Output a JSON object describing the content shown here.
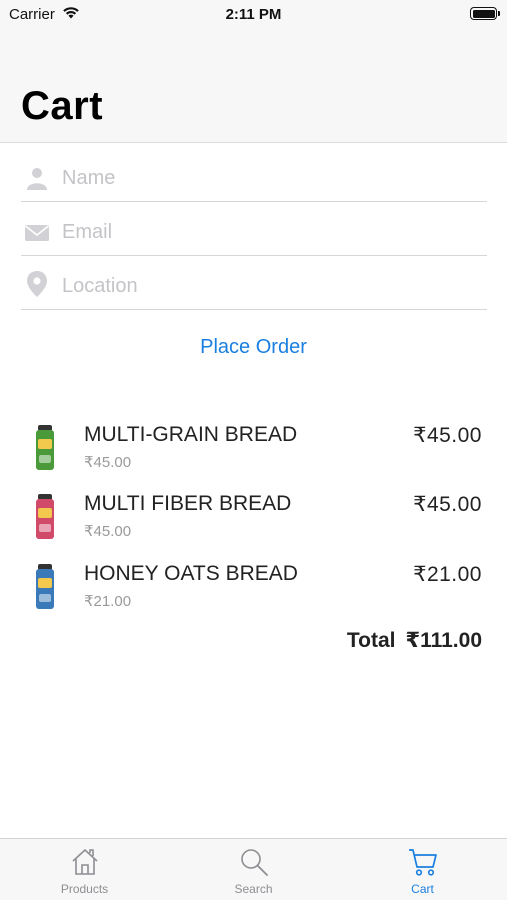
{
  "status_bar": {
    "carrier": "Carrier",
    "time": "2:11 PM"
  },
  "header": {
    "title": "Cart"
  },
  "form": {
    "name": {
      "value": "",
      "placeholder": "Name",
      "icon": "person-icon"
    },
    "email": {
      "value": "",
      "placeholder": "Email",
      "icon": "envelope-icon"
    },
    "location": {
      "value": "",
      "placeholder": "Location",
      "icon": "location-pin-icon"
    }
  },
  "place_order_label": "Place Order",
  "items": [
    {
      "name": "MULTI-GRAIN BREAD",
      "unit_price": "₹45.00",
      "total": "₹45.00",
      "pack_color": "#4a9a3a"
    },
    {
      "name": "MULTI FIBER BREAD",
      "unit_price": "₹45.00",
      "total": "₹45.00",
      "pack_color": "#d24a6a"
    },
    {
      "name": "HONEY OATS BREAD",
      "unit_price": "₹21.00",
      "total": "₹21.00",
      "pack_color": "#3a7ab8"
    }
  ],
  "total": {
    "label": "Total",
    "value": "₹111.00"
  },
  "tab_bar": {
    "tabs": [
      {
        "label": "Products",
        "icon": "home-icon",
        "active": false
      },
      {
        "label": "Search",
        "icon": "search-icon",
        "active": false
      },
      {
        "label": "Cart",
        "icon": "cart-icon",
        "active": true
      }
    ]
  },
  "colors": {
    "accent": "#1a7fe0",
    "inactive": "#8e8e93",
    "header_bg": "#f7f7f7"
  }
}
